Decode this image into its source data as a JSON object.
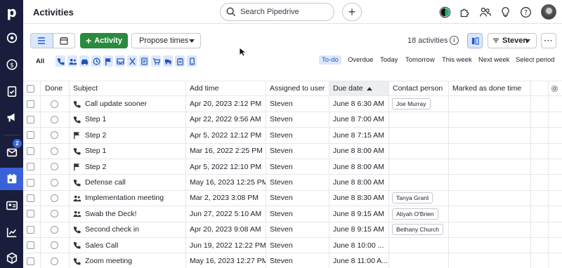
{
  "app": {
    "logo_letter": "p",
    "mail_badge": "2"
  },
  "nav": [
    {
      "name": "nav-leads-icon"
    },
    {
      "name": "nav-deals-icon"
    },
    {
      "name": "nav-projects-icon"
    },
    {
      "name": "nav-campaigns-icon"
    },
    {
      "name": "nav-mail-icon"
    },
    {
      "name": "nav-activities-icon"
    },
    {
      "name": "nav-contacts-icon"
    },
    {
      "name": "nav-insights-icon"
    },
    {
      "name": "nav-products-icon"
    }
  ],
  "header": {
    "title": "Activities",
    "search_placeholder": "Search Pipedrive",
    "add_label": "+"
  },
  "toolbar": {
    "add_activity_label": "Activity",
    "propose_label": "Propose times",
    "count_label": "18 activities",
    "filter_label": "Steven",
    "more_label": "···"
  },
  "filters": {
    "all_label": "All",
    "type_icons": [
      "call-icon",
      "meeting-icon",
      "car-icon",
      "clock-icon",
      "flag-icon",
      "inbox-icon",
      "lunch-icon",
      "document-icon",
      "cart-icon",
      "truck-icon",
      "clipboard-icon",
      "phone-icon"
    ],
    "periods": [
      "To-do",
      "Overdue",
      "Today",
      "Tomorrow",
      "This week",
      "Next week",
      "Select period"
    ],
    "selected_period": "To-do"
  },
  "table": {
    "columns": [
      "Done",
      "Subject",
      "Add time",
      "Assigned to user",
      "Due date",
      "Contact person",
      "Marked as done time"
    ],
    "rows": [
      {
        "type": "call",
        "subject": "Call update sooner",
        "add_time": "Apr 20, 2023 2:12 PM",
        "assigned": "Steven",
        "due": "June 8 6:30 AM",
        "contact": "Joe Murray"
      },
      {
        "type": "call",
        "subject": "Step 1",
        "add_time": "Apr 22, 2022 9:56 AM",
        "assigned": "Steven",
        "due": "June 8 7:00 AM",
        "contact": ""
      },
      {
        "type": "flag",
        "subject": "Step 2",
        "add_time": "Apr 5, 2022 12:12 PM",
        "assigned": "Steven",
        "due": "June 8 7:15 AM",
        "contact": ""
      },
      {
        "type": "call",
        "subject": "Step 1",
        "add_time": "Mar 16, 2022 2:25 PM",
        "assigned": "Steven",
        "due": "June 8 8:00 AM",
        "contact": ""
      },
      {
        "type": "flag",
        "subject": "Step 2",
        "add_time": "Apr 5, 2022 12:10 PM",
        "assigned": "Steven",
        "due": "June 8 8:00 AM",
        "contact": ""
      },
      {
        "type": "call",
        "subject": "Defense call",
        "add_time": "May 16, 2023 12:25 PM",
        "assigned": "Steven",
        "due": "June 8 8:00 AM",
        "contact": ""
      },
      {
        "type": "meeting",
        "subject": "Implementation meeting",
        "add_time": "Mar 2, 2023 3:08 PM",
        "assigned": "Steven",
        "due": "June 8 8:30 AM",
        "contact": "Tanya Grant"
      },
      {
        "type": "meeting",
        "subject": "Swab the Deck!",
        "add_time": "Jun 27, 2022 5:10 AM",
        "assigned": "Steven",
        "due": "June 8 9:15 AM",
        "contact": "Aliyah O'Brien"
      },
      {
        "type": "call",
        "subject": "Second check in",
        "add_time": "Apr 20, 2023 9:08 AM",
        "assigned": "Steven",
        "due": "June 8 9:15 AM",
        "contact": "Bethany Church"
      },
      {
        "type": "call",
        "subject": "Sales Call",
        "add_time": "Jun 19, 2022 12:22 PM",
        "assigned": "Steven",
        "due": "June 8 10:00 ...",
        "contact": ""
      },
      {
        "type": "call",
        "subject": "Zoom meeting",
        "add_time": "May 16, 2023 12:27 PM",
        "assigned": "Steven",
        "due": "June 8 11:00 A...",
        "contact": ""
      }
    ]
  },
  "colors": {
    "nav_bg": "#1a1d3b",
    "accent": "#3a62d8",
    "primary_button": "#2a8a3e",
    "selection_bg": "#dce7fb"
  }
}
